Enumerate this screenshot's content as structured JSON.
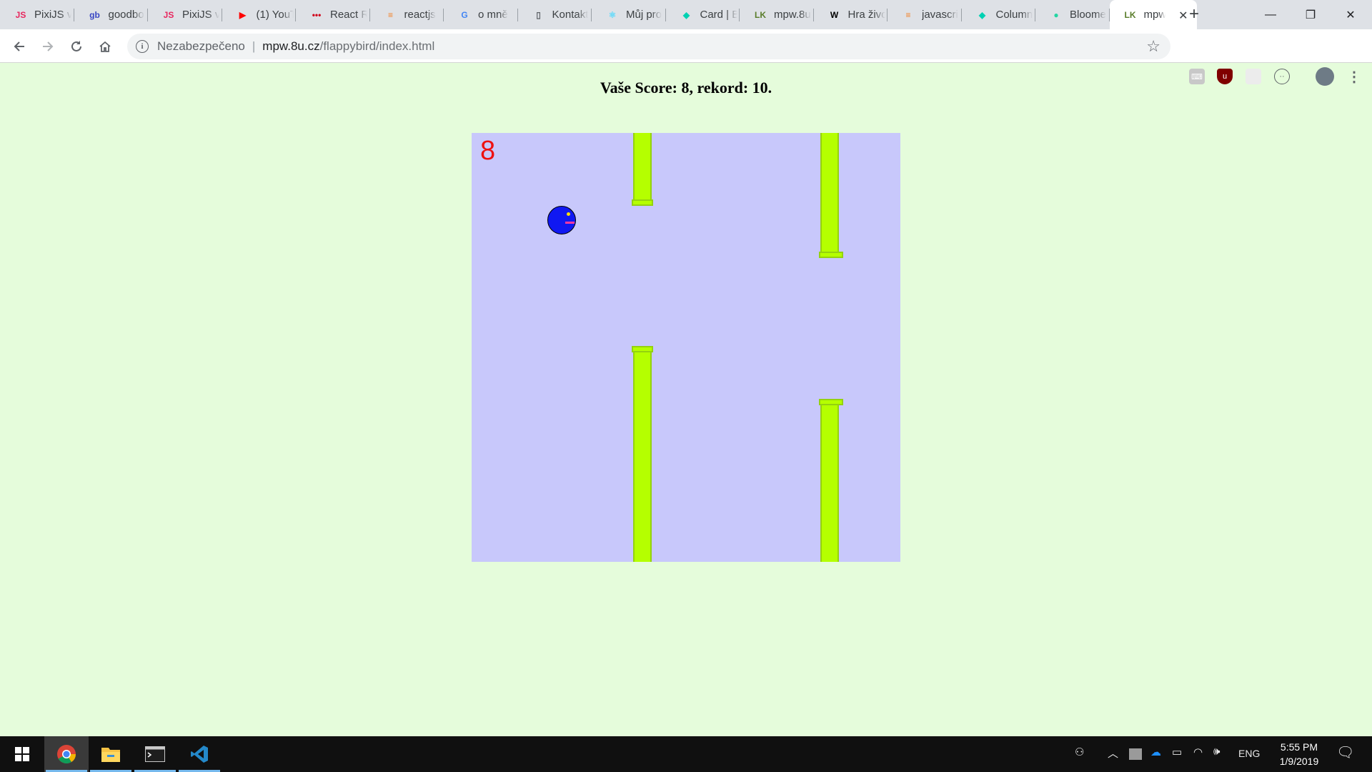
{
  "browser": {
    "tabs": [
      {
        "title": "PixiJS v",
        "favicon": "js-icon",
        "fav_text": "JS",
        "fav_color": "#e8265e"
      },
      {
        "title": "goodbo",
        "favicon": "goodboy-icon",
        "fav_text": "gb",
        "fav_color": "#3946c4"
      },
      {
        "title": "PixiJS v",
        "favicon": "js-icon",
        "fav_text": "JS",
        "fav_color": "#e8265e"
      },
      {
        "title": "(1) YouT",
        "favicon": "youtube-icon",
        "fav_text": "▶",
        "fav_color": "#ff0000"
      },
      {
        "title": "React R",
        "favicon": "react-router-icon",
        "fav_text": "•••",
        "fav_color": "#d0021b"
      },
      {
        "title": "reactjs",
        "favicon": "stackoverflow-icon",
        "fav_text": "≡",
        "fav_color": "#f48024"
      },
      {
        "title": "o mně",
        "favicon": "google-icon",
        "fav_text": "G",
        "fav_color": "#4285f4"
      },
      {
        "title": "Kontakt",
        "favicon": "document-icon",
        "fav_text": "▯",
        "fav_color": "#5f6368"
      },
      {
        "title": "Můj pro",
        "favicon": "react-icon",
        "fav_text": "⚛",
        "fav_color": "#61dafb"
      },
      {
        "title": "Card | B",
        "favicon": "bloomer-icon",
        "fav_text": "◆",
        "fav_color": "#00d1b2"
      },
      {
        "title": "mpw.8u",
        "favicon": "lk-icon",
        "fav_text": "LK",
        "fav_color": "#5a7d2b"
      },
      {
        "title": "Hra živo",
        "favicon": "wikipedia-icon",
        "fav_text": "W",
        "fav_color": "#000000"
      },
      {
        "title": "javascri",
        "favicon": "stackoverflow-icon",
        "fav_text": "≡",
        "fav_color": "#f48024"
      },
      {
        "title": "Column",
        "favicon": "bloomer-icon",
        "fav_text": "◆",
        "fav_color": "#00d1b2"
      },
      {
        "title": "Bloome",
        "favicon": "chat-icon",
        "fav_text": "●",
        "fav_color": "#23d5a3"
      },
      {
        "title": "mpw",
        "favicon": "lk-icon",
        "fav_text": "LK",
        "fav_color": "#5a7d2b",
        "active": true
      }
    ],
    "new_tab": "+",
    "window_controls": {
      "minimize": "—",
      "restore": "❐",
      "close": "✕"
    },
    "address": {
      "security_label": "Nezabezpečeno",
      "separator": "|",
      "host": "mpw.8u.cz",
      "path": "/flappybird/index.html"
    }
  },
  "page": {
    "score_heading": "Vaše Score: 8, rekord: 10."
  },
  "game": {
    "score": "8",
    "colors": {
      "page_bg": "#e5fcdb",
      "canvas_bg": "#c8c8fb",
      "pipe": "#b5ff00",
      "pipe_border": "#94d20f",
      "bird": "#1018f2",
      "score_text": "#ee1111"
    }
  },
  "taskbar": {
    "apps": [
      {
        "name": "chrome-icon",
        "running": true,
        "active": true
      },
      {
        "name": "file-explorer-icon",
        "running": true
      },
      {
        "name": "terminal-icon",
        "running": true
      },
      {
        "name": "vscode-icon",
        "running": true
      }
    ],
    "tray": {
      "language": "ENG",
      "time": "5:55 PM",
      "date": "1/9/2019"
    }
  }
}
